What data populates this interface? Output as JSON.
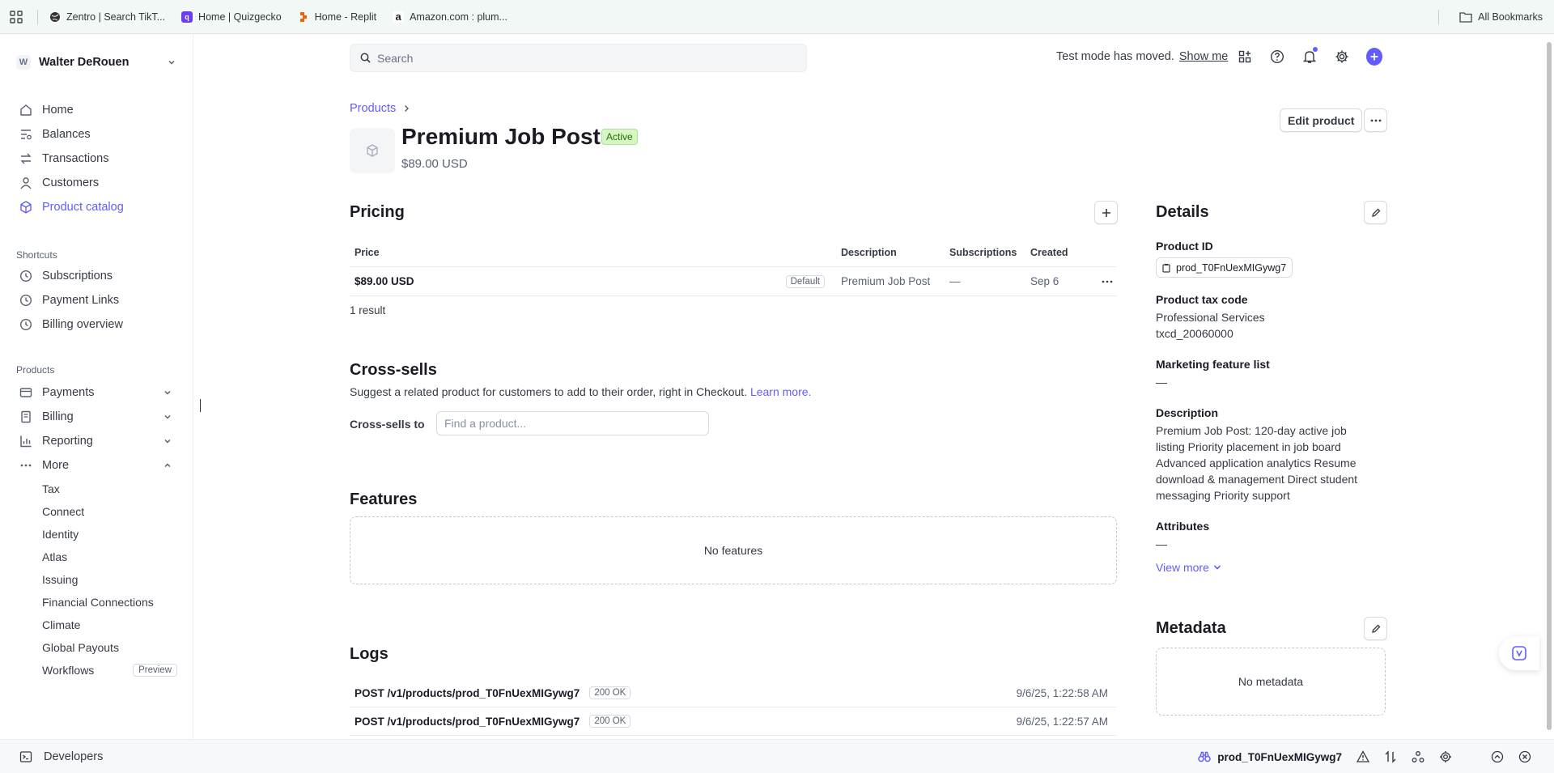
{
  "bookmarks": {
    "items": [
      {
        "label": "Zentro | Search TikT...",
        "color": "#333333"
      },
      {
        "label": "Home | Quizgecko",
        "color": "#6c3cf0"
      },
      {
        "label": "Home - Replit",
        "color": "#f26207"
      },
      {
        "label": "Amazon.com : plum...",
        "color": "#222222"
      }
    ],
    "all_label": "All Bookmarks"
  },
  "sidebar": {
    "account_initial": "W",
    "account_name": "Walter DeRouen",
    "main_nav": [
      {
        "label": "Home",
        "icon": "home-icon"
      },
      {
        "label": "Balances",
        "icon": "balances-icon"
      },
      {
        "label": "Transactions",
        "icon": "transactions-icon"
      },
      {
        "label": "Customers",
        "icon": "customers-icon"
      },
      {
        "label": "Product catalog",
        "icon": "product-catalog-icon",
        "active": true
      }
    ],
    "shortcuts_heading": "Shortcuts",
    "shortcuts": [
      {
        "label": "Subscriptions",
        "icon": "clock-icon"
      },
      {
        "label": "Payment Links",
        "icon": "clock-icon"
      },
      {
        "label": "Billing overview",
        "icon": "clock-icon"
      }
    ],
    "products_heading": "Products",
    "products": [
      {
        "label": "Payments",
        "icon": "payments-icon"
      },
      {
        "label": "Billing",
        "icon": "billing-icon"
      },
      {
        "label": "Reporting",
        "icon": "reporting-icon"
      },
      {
        "label": "More",
        "icon": "more-icon"
      }
    ],
    "more_items": [
      "Tax",
      "Connect",
      "Identity",
      "Atlas",
      "Issuing",
      "Financial Connections",
      "Climate",
      "Global Payouts",
      "Workflows"
    ],
    "workflows_badge": "Preview"
  },
  "header": {
    "search_placeholder": "Search",
    "test_mode_text": "Test mode has moved.",
    "show_me": "Show me"
  },
  "product": {
    "breadcrumb": "Products",
    "name": "Premium Job Post",
    "status": "Active",
    "price": "$89.00 USD",
    "edit_label": "Edit product"
  },
  "pricing": {
    "heading": "Pricing",
    "columns": [
      "Price",
      "Description",
      "Subscriptions",
      "Created"
    ],
    "rows": [
      {
        "price": "$89.00 USD",
        "badge": "Default",
        "description": "Premium Job Post",
        "subscriptions": "—",
        "created": "Sep 6"
      }
    ],
    "result_count": "1 result"
  },
  "cross_sells": {
    "heading": "Cross-sells",
    "description": "Suggest a related product for customers to add to their order, right in Checkout.",
    "learn_more": "Learn more.",
    "label": "Cross-sells to",
    "placeholder": "Find a product..."
  },
  "features": {
    "heading": "Features",
    "empty": "No features"
  },
  "logs": {
    "heading": "Logs",
    "rows": [
      {
        "request": "POST /v1/products/prod_T0FnUexMIGywg7",
        "status": "200 OK",
        "time": "9/6/25, 1:22:58 AM"
      },
      {
        "request": "POST /v1/products/prod_T0FnUexMIGywg7",
        "status": "200 OK",
        "time": "9/6/25, 1:22:57 AM"
      }
    ]
  },
  "details": {
    "heading": "Details",
    "product_id_label": "Product ID",
    "product_id": "prod_T0FnUexMIGywg7",
    "tax_code_label": "Product tax code",
    "tax_code_name": "Professional Services",
    "tax_code_id": "txcd_20060000",
    "marketing_label": "Marketing feature list",
    "marketing_value": "—",
    "description_label": "Description",
    "description": "Premium Job Post: 120-day active job listing Priority placement in job board Advanced application analytics Resume download & management Direct student messaging Priority support",
    "attributes_label": "Attributes",
    "attributes_value": "—",
    "view_more": "View more"
  },
  "metadata": {
    "heading": "Metadata",
    "empty": "No metadata"
  },
  "bottom_bar": {
    "developers": "Developers",
    "object_id": "prod_T0FnUexMIGywg7"
  },
  "colors": {
    "accent": "#635bff",
    "active_badge_bg": "#d7f7c2",
    "active_badge_text": "#217005"
  }
}
